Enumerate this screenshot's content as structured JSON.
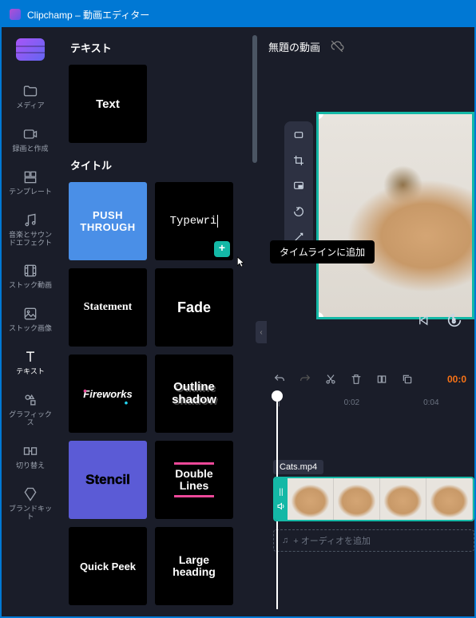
{
  "titlebar": {
    "title": "Clipchamp – 動画エディター"
  },
  "sidebar": {
    "items": [
      {
        "label": "メディア"
      },
      {
        "label": "録画と作成"
      },
      {
        "label": "テンプレート"
      },
      {
        "label": "音楽とサウンドエフェクト"
      },
      {
        "label": "ストック動画"
      },
      {
        "label": "ストック画像"
      },
      {
        "label": "テキスト"
      },
      {
        "label": "グラフィックス"
      },
      {
        "label": "切り替え"
      },
      {
        "label": "ブランドキット"
      }
    ]
  },
  "panel": {
    "section_text": "テキスト",
    "section_title": "タイトル",
    "tiles": {
      "text": "Text",
      "push": "PUSH THROUGH",
      "typewriter": "Typewri",
      "statement": "Statement",
      "fade": "Fade",
      "fireworks": "Fireworks",
      "outline": "Outline\nshadow",
      "stencil": "Stencil",
      "double": "Double\nLines",
      "quick": "Quick Peek",
      "large": "Large\nheading"
    }
  },
  "tooltip": {
    "add_to_timeline": "タイムラインに追加"
  },
  "preview": {
    "title": "無題の動画"
  },
  "timeline": {
    "timecode": "00:0",
    "marks": [
      "|",
      "0:02",
      "0:04"
    ],
    "clip_name": "Cats.mp4",
    "audio_hint": "+ オーディオを追加"
  }
}
